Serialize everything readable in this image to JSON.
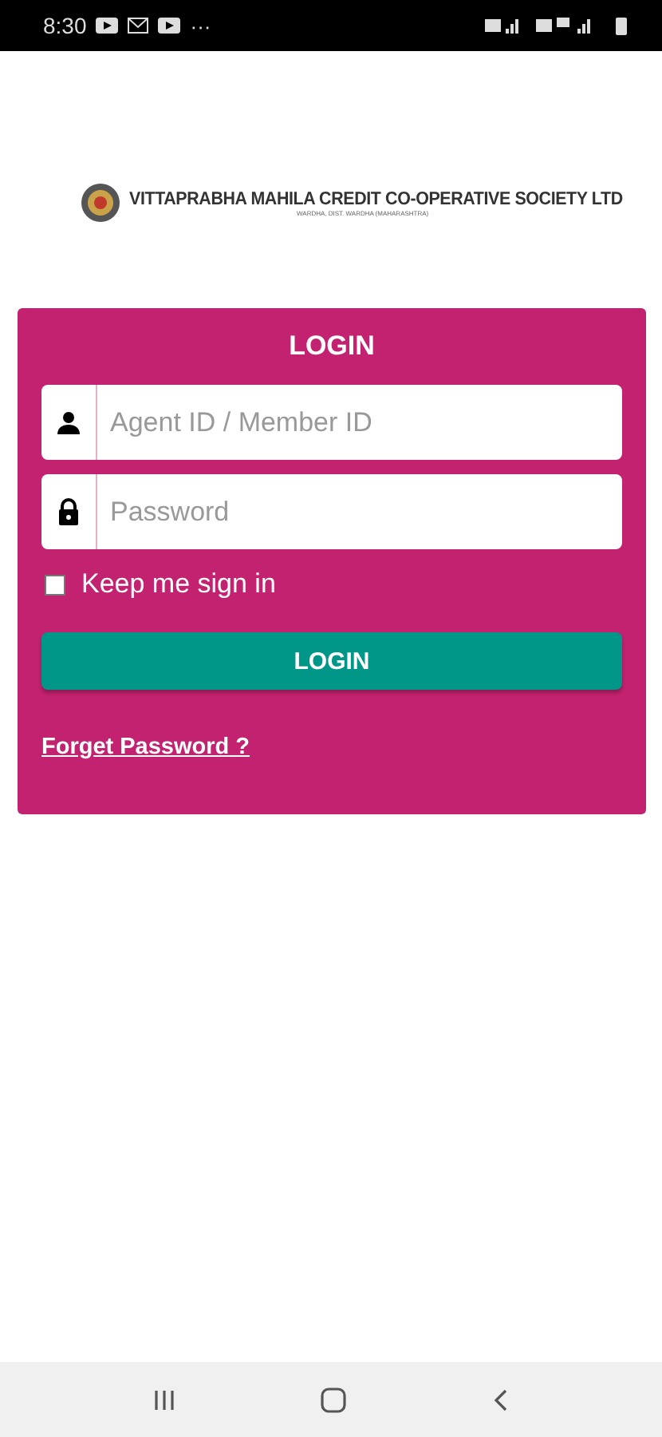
{
  "status_bar": {
    "time": "8:30",
    "more": "···"
  },
  "header": {
    "title": "VITTAPRABHA MAHILA CREDIT CO-OPERATIVE SOCIETY LTD",
    "subtitle": "WARDHA, DIST. WARDHA (MAHARASHTRA)"
  },
  "login_card": {
    "title": "LOGIN",
    "fields": [
      {
        "kind": "user",
        "placeholder": "Agent ID / Member ID"
      },
      {
        "kind": "password",
        "placeholder": "Password"
      }
    ],
    "keep_signed_in": {
      "label": "Keep me sign in",
      "checked": false
    },
    "button": "LOGIN",
    "forgot_link": "Forget Password ?"
  }
}
